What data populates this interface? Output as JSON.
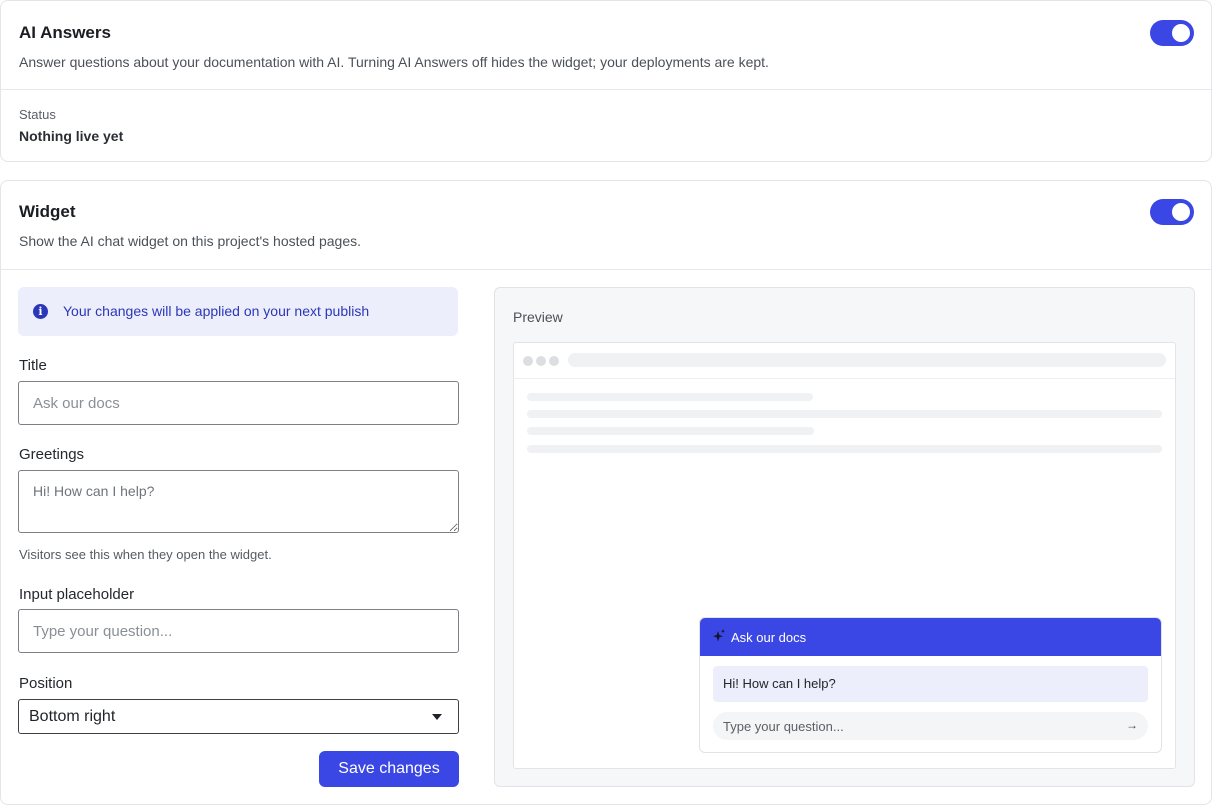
{
  "ai_answers": {
    "title": "AI Answers",
    "description": "Answer questions about your documentation with AI. Turning AI Answers off hides the widget; your deployments are kept.",
    "enabled": true,
    "status_label": "Status",
    "status_value": "Nothing live yet"
  },
  "widget": {
    "title": "Widget",
    "description": "Show the AI chat widget on this project's hosted pages.",
    "enabled": true,
    "info_banner": "Your changes will be applied on your next publish",
    "info_icon": "info-circle-icon",
    "fields": {
      "title_label": "Title",
      "title_placeholder": "Ask our docs",
      "greetings_label": "Greetings",
      "greetings_placeholder": "Hi! How can I help?",
      "greetings_hint": "Visitors see this when they open the widget.",
      "input_placeholder_label": "Input placeholder",
      "input_placeholder_placeholder": "Type your question...",
      "position_label": "Position",
      "position_value": "Bottom right"
    },
    "save_label": "Save changes"
  },
  "preview": {
    "label": "Preview",
    "chat_title": "Ask our docs",
    "chat_icon": "sparkle-icon",
    "greeting": "Hi! How can I help?",
    "input_placeholder": "Type your question...",
    "send_icon": "arrow-right-icon"
  },
  "colors": {
    "accent": "#3a47e5",
    "banner_bg": "#eceefb",
    "banner_text": "#2b37b8"
  }
}
